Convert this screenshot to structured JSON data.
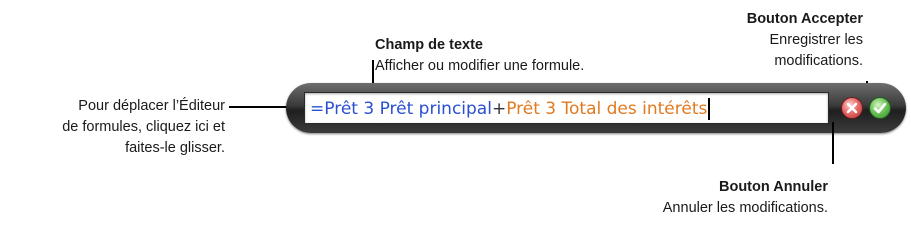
{
  "callouts": {
    "text_field": {
      "title": "Champ de texte",
      "desc": "Afficher ou modifier une formule."
    },
    "accept_button": {
      "title": "Bouton Accepter",
      "desc_line1": "Enregistrer les",
      "desc_line2": "modifications."
    },
    "drag_handle": {
      "line1": "Pour déplacer l’Éditeur",
      "line2": "de formules, cliquez ici et",
      "line3": "faites-le glisser."
    },
    "cancel_button": {
      "title": "Bouton Annuler",
      "desc": "Annuler les modifications."
    }
  },
  "formula": {
    "equals": "=",
    "ref1": "Prêt 3 Prêt principal",
    "operator": "+",
    "ref2": "Prêt 3 Total des intérêts"
  },
  "colors": {
    "ref1": "#2a4fd2",
    "ref2": "#e3791f",
    "cancel": "#d04545",
    "accept": "#4caf3a"
  },
  "icons": {
    "cancel": "x-icon",
    "accept": "checkmark-icon"
  }
}
